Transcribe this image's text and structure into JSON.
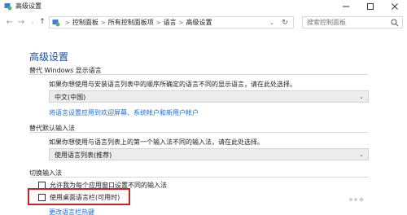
{
  "window": {
    "title": "高级设置",
    "icon": "language-settings-icon",
    "min_icon": "minimize-icon",
    "max_icon": "maximize-icon",
    "close_icon": "close-icon"
  },
  "nav": {
    "back": "←",
    "forward": "→",
    "recent": "⌄",
    "up": "↑"
  },
  "address": {
    "icon": "language-settings-icon",
    "separator": ">",
    "segments": [
      "控制面板",
      "所有控制面板项",
      "语言",
      "高级设置"
    ],
    "dropdown": "⌄",
    "refresh": "↻"
  },
  "search": {
    "placeholder": "搜索控制面板",
    "icon": "search-icon"
  },
  "page": {
    "title": "高级设置"
  },
  "sections": {
    "display_language": {
      "title": "替代 Windows 显示语言",
      "description": "如果你想使用与安装语言列表中的顺序所确定的语言不同的显示语言，请在此处选择。",
      "selected": "中文(中国)",
      "link": "将语言设置应用到欢迎屏幕、系统帐户和新用户帐户"
    },
    "input_method": {
      "title": "替代默认输入法",
      "description": "如果你想使用与语言列表上的第一个输入法不同的输入法，请在此处选择。",
      "selected": "使用语言列表(推荐)"
    },
    "switch_input": {
      "title": "切换输入法",
      "checkbox1": "允许我为每个应用窗口设置不同的输入法",
      "checkbox2": "使用桌面语言栏(可用时)",
      "link": "更改语言栏热键"
    }
  },
  "accent_color": "#1a4fa0",
  "highlight_color": "#c9222a"
}
